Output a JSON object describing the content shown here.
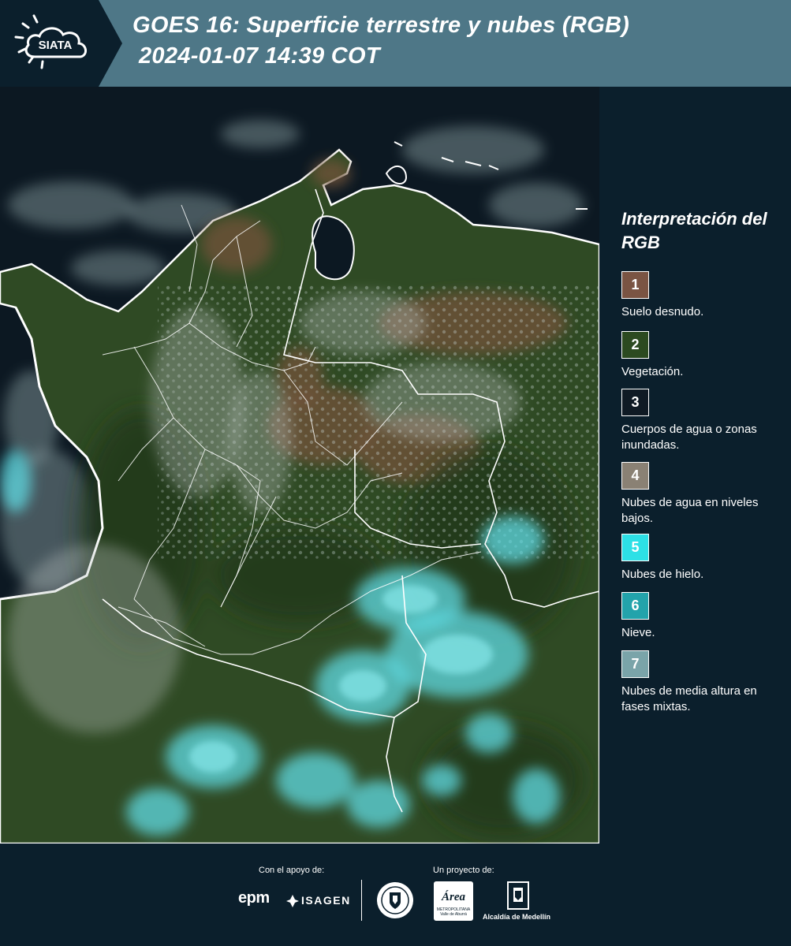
{
  "header": {
    "logo_text": "SIATA",
    "title_line1": "GOES 16: Superficie terrestre y nubes (RGB)",
    "title_line2": "2024-01-07 14:39 COT"
  },
  "colors": {
    "header_bg": "#4e7787",
    "panel_bg": "#0b1f2c",
    "ocean": "#0c1822",
    "land_vegetation": "#2f4a24",
    "cloud_ice": "#5fd6e0"
  },
  "legend": {
    "title": "Interpretación del RGB",
    "items": [
      {
        "number": "1",
        "label": "Suelo desnudo.",
        "color": "#7a5443"
      },
      {
        "number": "2",
        "label": "Vegetación.",
        "color": "#2c4a20"
      },
      {
        "number": "3",
        "label": "Cuerpos de agua o zonas inundadas.",
        "color": "#0f1a24"
      },
      {
        "number": "4",
        "label": "Nubes de agua en niveles bajos.",
        "color": "#8a8174"
      },
      {
        "number": "5",
        "label": "Nubes de hielo.",
        "color": "#2de0e6"
      },
      {
        "number": "6",
        "label": "Nieve.",
        "color": "#23a3ab"
      },
      {
        "number": "7",
        "label": "Nubes de media altura en fases mixtas.",
        "color": "#7aa4a9"
      }
    ]
  },
  "footer": {
    "support_label": "Con el apoyo de:",
    "project_label": "Un proyecto de:",
    "epm": "epm",
    "isagen": "ISAGEN",
    "area_text": "Área",
    "area_sub": "METROPOLITANA Valle de Aburrá",
    "alcaldia": "Alcaldía de Medellín"
  }
}
